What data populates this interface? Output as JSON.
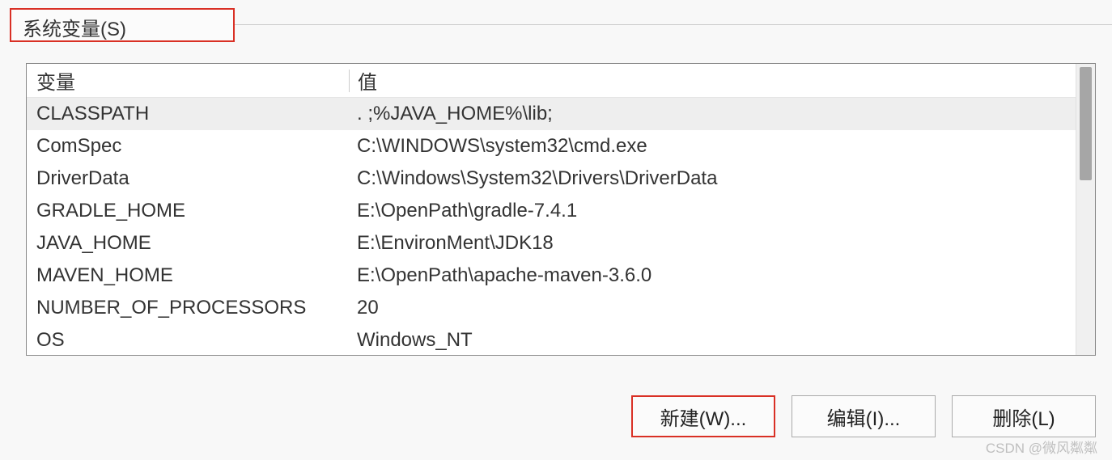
{
  "section": {
    "title": "系统变量(S)"
  },
  "table": {
    "header": {
      "variable": "变量",
      "value": "值"
    },
    "rows": [
      {
        "variable": "CLASSPATH",
        "value": ". ;%JAVA_HOME%\\lib;",
        "selected": true
      },
      {
        "variable": "ComSpec",
        "value": "C:\\WINDOWS\\system32\\cmd.exe",
        "selected": false
      },
      {
        "variable": "DriverData",
        "value": "C:\\Windows\\System32\\Drivers\\DriverData",
        "selected": false
      },
      {
        "variable": "GRADLE_HOME",
        "value": "E:\\OpenPath\\gradle-7.4.1",
        "selected": false
      },
      {
        "variable": "JAVA_HOME",
        "value": "E:\\EnvironMent\\JDK18",
        "selected": false
      },
      {
        "variable": "MAVEN_HOME",
        "value": "E:\\OpenPath\\apache-maven-3.6.0",
        "selected": false
      },
      {
        "variable": "NUMBER_OF_PROCESSORS",
        "value": "20",
        "selected": false
      },
      {
        "variable": "OS",
        "value": "Windows_NT",
        "selected": false
      }
    ]
  },
  "buttons": {
    "new": "新建(W)...",
    "edit": "编辑(I)...",
    "delete": "删除(L)"
  },
  "watermark": "CSDN @微风粼粼"
}
